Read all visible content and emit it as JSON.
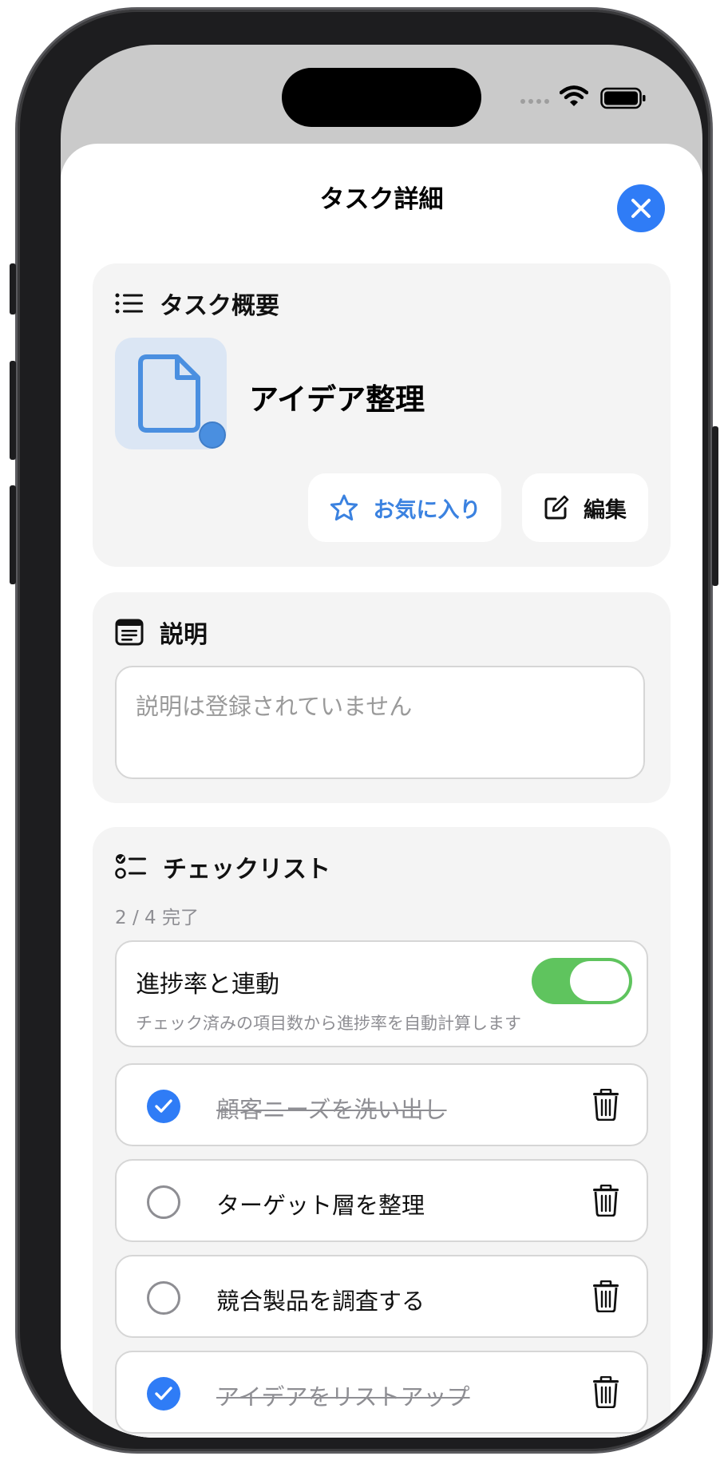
{
  "sheet": {
    "title": "タスク詳細"
  },
  "overview": {
    "heading": "タスク概要",
    "task_name": "アイデア整理",
    "favorite_label": "お気に入り",
    "edit_label": "編集"
  },
  "description": {
    "heading": "説明",
    "placeholder": "説明は登録されていません"
  },
  "checklist": {
    "heading": "チェックリスト",
    "progress": "2 / 4 完了",
    "sync": {
      "title": "進捗率と連動",
      "description": "チェック済みの項目数から進捗率を自動計算します",
      "enabled": true
    },
    "items": [
      {
        "label": "顧客ニーズを洗い出し",
        "done": true
      },
      {
        "label": "ターゲット層を整理",
        "done": false
      },
      {
        "label": "競合製品を調査する",
        "done": false
      },
      {
        "label": "アイデアをリストアップ",
        "done": true
      }
    ]
  },
  "colors": {
    "accent": "#2f7cf6",
    "toggle_on": "#5fc45e",
    "card_bg": "#f4f4f4"
  }
}
